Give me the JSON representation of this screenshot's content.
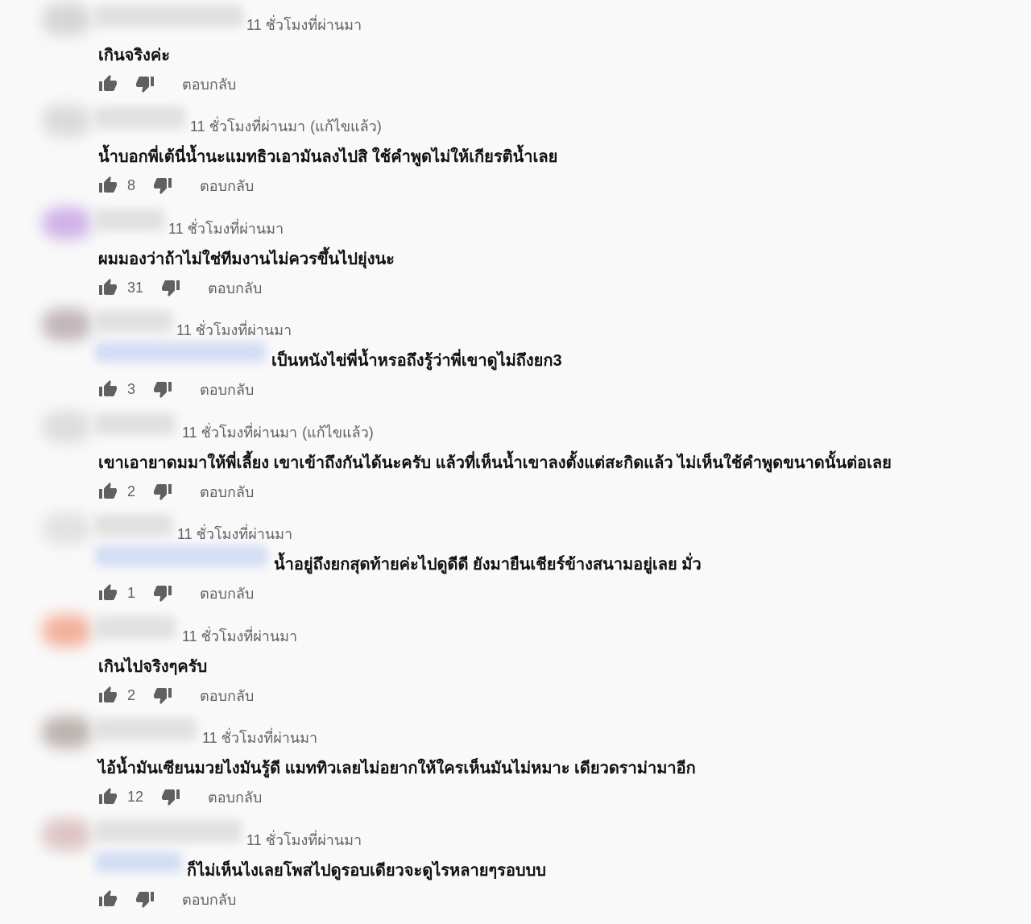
{
  "comments": [
    {
      "timestamp": "11 ชั่วโมงที่ผ่านมา",
      "edited": "",
      "reply_to": false,
      "text": "เกินจริงค่ะ",
      "likes": "",
      "avatar_color": "#cfcfcf",
      "reply_label": "ตอบกลับ"
    },
    {
      "timestamp": "11 ชั่วโมงที่ผ่านมา",
      "edited": "(แก้ไขแล้ว)",
      "reply_to": false,
      "text": "น้ำบอกพี่เต้นี่น้ำนะแมทธิวเอามันลงไปสิ ใช้คำพูดไม่ให้เกียรติน้ำเลย",
      "likes": "8",
      "avatar_color": "#d5d5d5",
      "reply_label": "ตอบกลับ"
    },
    {
      "timestamp": "11 ชั่วโมงที่ผ่านมา",
      "edited": "",
      "reply_to": false,
      "text": "ผมมองว่าถ้าไม่ใช่ทีมงานไม่ควรขึ้นไปยุ่งนะ",
      "likes": "31",
      "avatar_color": "#c9a6e6",
      "reply_label": "ตอบกลับ"
    },
    {
      "timestamp": "11 ชั่วโมงที่ผ่านมา",
      "edited": "",
      "reply_to": true,
      "text": "เป็นหนังไข่พี่น้ำหรอถึงรู้ว่าพี่เขาดูไม่ถึงยก3",
      "likes": "3",
      "avatar_color": "#b7aab0",
      "reply_label": "ตอบกลับ"
    },
    {
      "timestamp": "11 ชั่วโมงที่ผ่านมา",
      "edited": "(แก้ไขแล้ว)",
      "reply_to": false,
      "text": "เขาเอายาดมมาให้พี่เลี้ยง เขาเข้าถึงกันได้นะครับ แล้วที่เห็นน้ำเขาลงตั้งแต่สะกิดแล้ว ไม่เห็นใช้คำพูดขนาดนั้นต่อเลย",
      "likes": "2",
      "avatar_color": "#d8d8d8",
      "reply_label": "ตอบกลับ"
    },
    {
      "timestamp": "11 ชั่วโมงที่ผ่านมา",
      "edited": "",
      "reply_to": true,
      "text": "น้ำอยู่ถึงยกสุดท้ายค่ะไปดูดีดี ยังมายืนเชียร์ข้างสนามอยู่เลย มั่ว",
      "likes": "1",
      "avatar_color": "#dedede",
      "reply_label": "ตอบกลับ"
    },
    {
      "timestamp": "11 ชั่วโมงที่ผ่านมา",
      "edited": "",
      "reply_to": false,
      "text": "เกินไปจริงๆครับ",
      "likes": "2",
      "avatar_color": "#f2a58c",
      "reply_label": "ตอบกลับ"
    },
    {
      "timestamp": "11 ชั่วโมงที่ผ่านมา",
      "edited": "",
      "reply_to": false,
      "text": "ไอ้น้ำมันเซียนมวยไงมันรู้ดี แมททิวเลยไม่อยากให้ใครเห็นมันไม่หมาะ เดียวดราม่ามาอีก",
      "likes": "12",
      "avatar_color": "#b2a8a4",
      "reply_label": "ตอบกลับ"
    },
    {
      "timestamp": "11 ชั่วโมงที่ผ่านมา",
      "edited": "",
      "reply_to": true,
      "text": "ก็ไม่เห็นไงเลยโพสไปดูรอบเดียวจะดูไรหลายๆรอบบบ",
      "likes": "",
      "avatar_color": "#d9bcbc",
      "reply_label": "ตอบกลับ"
    }
  ],
  "icons": {
    "like": "thumb-up-icon",
    "dislike": "thumb-down-icon"
  },
  "colors": {
    "background": "#f9f9f9",
    "meta_text": "#606060",
    "body_text": "#111111"
  }
}
